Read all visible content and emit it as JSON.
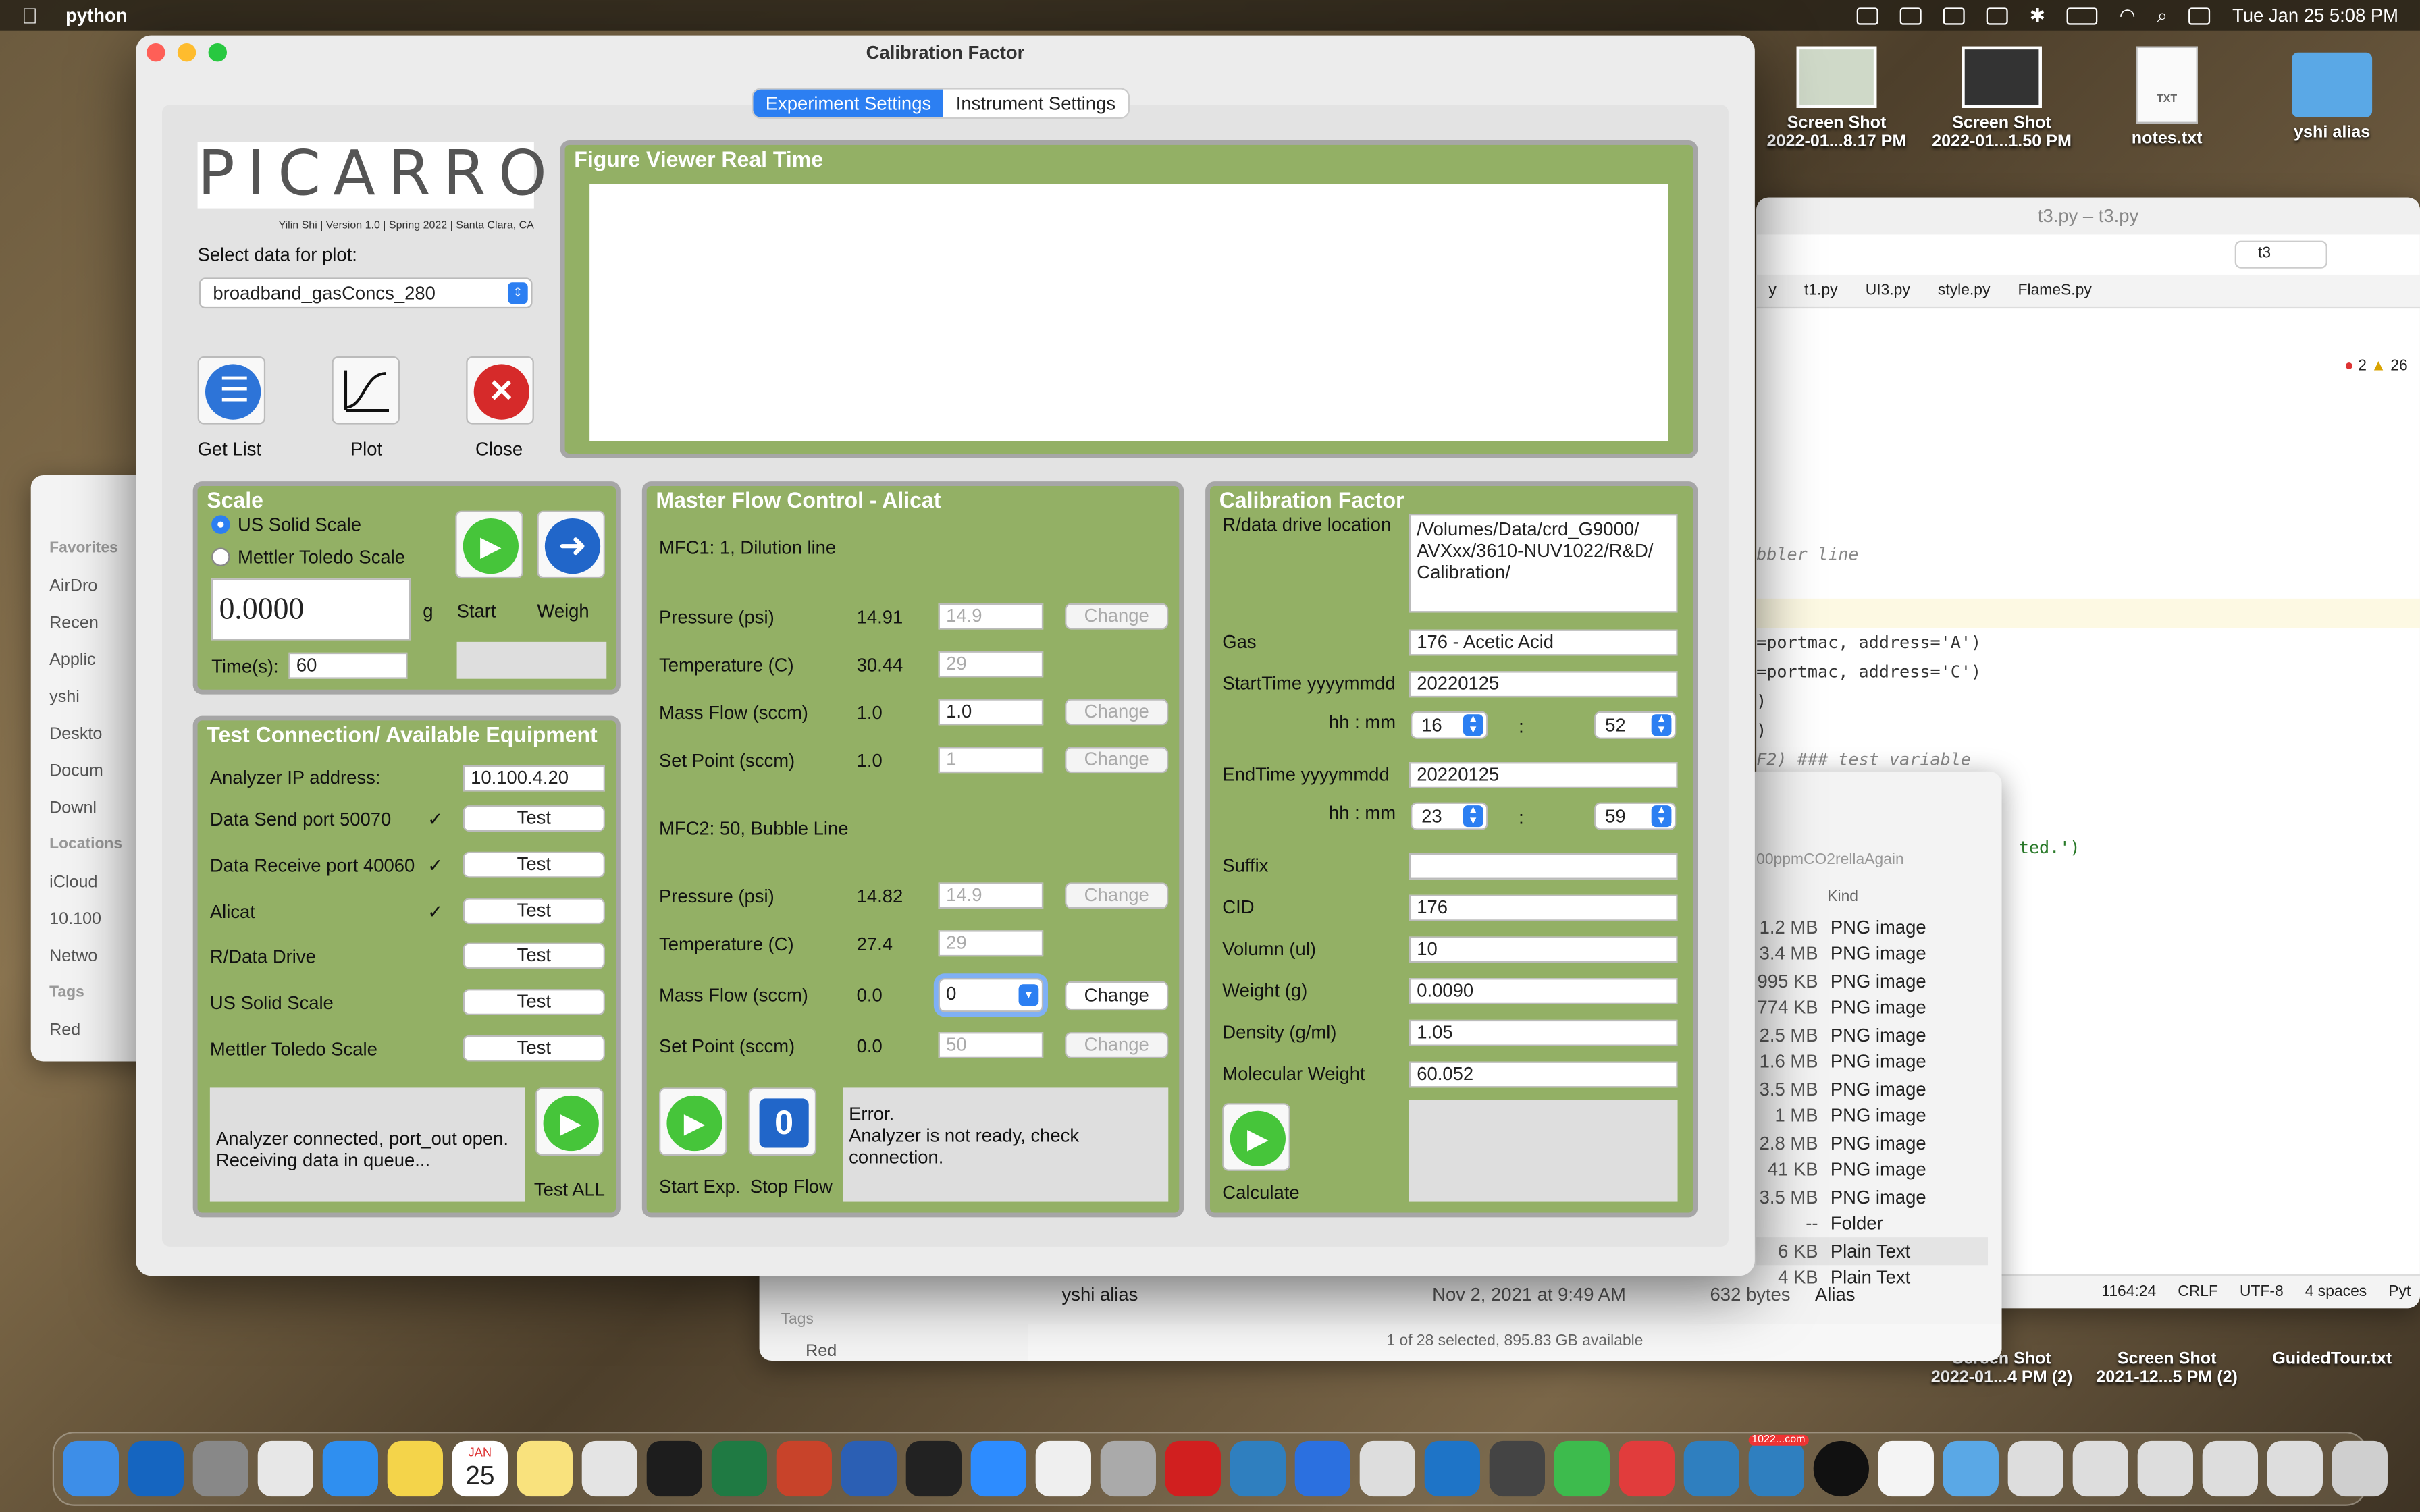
{
  "menubar": {
    "apple": "",
    "app_name": "python",
    "clock": "Tue Jan 25  5:08 PM"
  },
  "desktop": {
    "icons": [
      {
        "label": "Screen Shot\n2022-01...8.17 PM"
      },
      {
        "label": "Screen Shot\n2022-01...1.50 PM"
      },
      {
        "label": "notes.txt"
      },
      {
        "label": "yshi alias"
      },
      {
        "label": "Screen Shot\n2022-01...4 PM (2)"
      },
      {
        "label": "Screen Shot\n2021-12...5 PM (2)"
      },
      {
        "label": "GuidedTour.txt"
      }
    ]
  },
  "ide": {
    "title": "t3.py – t3.py",
    "run_config": "t3",
    "tabs": [
      "y",
      "t1.py",
      "UI3.py",
      "style.py",
      "FlameS.py"
    ],
    "errors": "2",
    "warnings": "26",
    "code_lines": [
      "bbler line",
      "",
      "",
      "=portmac, address='A')",
      "=portmac, address='C')",
      ")",
      ")",
      "F2)  ### test variable",
      "",
      "",
      "ted.')"
    ],
    "status": [
      "1164:24",
      "CRLF",
      "UTF-8",
      "4 spaces",
      "Pyt"
    ]
  },
  "finder_left": {
    "favorites_header": "Favorites",
    "favorites": [
      "AirDro",
      "Recen",
      "Applic",
      "yshi",
      "Deskto",
      "Docum",
      "Downl"
    ],
    "locations_header": "Locations",
    "locations": [
      "iCloud",
      "10.100",
      "Netwo"
    ],
    "tags_header": "Tags",
    "tags": [
      "Red"
    ]
  },
  "finder2": {
    "path_crumb": "00ppmCO2rellaAgain",
    "kind_header": "Kind",
    "rows": [
      {
        "size": "1.2 MB",
        "kind": "PNG image"
      },
      {
        "size": "3.4 MB",
        "kind": "PNG image"
      },
      {
        "size": "995 KB",
        "kind": "PNG image"
      },
      {
        "size": "774 KB",
        "kind": "PNG image"
      },
      {
        "size": "2.5 MB",
        "kind": "PNG image"
      },
      {
        "size": "1.6 MB",
        "kind": "PNG image"
      },
      {
        "size": "3.5 MB",
        "kind": "PNG image"
      },
      {
        "size": "1 MB",
        "kind": "PNG image"
      },
      {
        "size": "2.8 MB",
        "kind": "PNG image"
      },
      {
        "size": "41 KB",
        "kind": "PNG image"
      },
      {
        "size": "3.5 MB",
        "kind": "PNG image"
      },
      {
        "size": "--",
        "kind": "Folder"
      },
      {
        "size": "6 KB",
        "kind": "Plain Text"
      },
      {
        "size": "4 KB",
        "kind": "Plain Text"
      }
    ],
    "alias_row": {
      "name": "yshi alias",
      "date": "Nov 2, 2021 at 9:49 AM",
      "size": "632 bytes",
      "kind": "Alias"
    },
    "tags_header": "Tags",
    "tag_red": "Red",
    "status": "1 of 28 selected, 895.83 GB available"
  },
  "window": {
    "title": "Calibration Factor",
    "tabs": {
      "experiment": "Experiment Settings",
      "instrument": "Instrument Settings"
    },
    "logo": "PICARRO",
    "credit": "Yilin Shi | Version 1.0 | Spring 2022 | Santa Clara, CA",
    "select_label": "Select data for plot:",
    "select_value": "broadband_gasConcs_280",
    "buttons": {
      "get_list": "Get List",
      "plot": "Plot",
      "close": "Close"
    },
    "figure": {
      "title": "Figure Viewer Real Time"
    },
    "scale": {
      "title": "Scale",
      "opt1": "US Solid Scale",
      "opt2": "Mettler Toledo Scale",
      "reading": "0.0000",
      "unit": "g",
      "time_label": "Time(s):",
      "time_value": "60",
      "start": "Start",
      "weigh": "Weigh"
    },
    "test": {
      "title": "Test Connection/ Available Equipment",
      "ip_label": "Analyzer IP address:",
      "ip_value": "10.100.4.20",
      "rows": [
        {
          "label": "Data Send port 50070",
          "check": "✓",
          "btn": "Test"
        },
        {
          "label": "Data Receive port 40060",
          "check": "✓",
          "btn": "Test"
        },
        {
          "label": "Alicat",
          "check": "✓",
          "btn": "Test"
        },
        {
          "label": "R/Data Drive",
          "check": "",
          "btn": "Test"
        },
        {
          "label": "US Solid Scale",
          "check": "",
          "btn": "Test"
        },
        {
          "label": "Mettler Toledo Scale",
          "check": "",
          "btn": "Test"
        }
      ],
      "status_line1": "Analyzer connected, port_out open.",
      "status_line2": "Receiving data in queue...",
      "test_all": "Test ALL"
    },
    "mfc": {
      "title": "Master Flow Control - Alicat",
      "mfc1_header": "MFC1: 1, Dilution line",
      "mfc1": [
        {
          "label": "Pressure (psi)",
          "value": "14.91",
          "input": "14.9",
          "dim": true,
          "btn": "Change",
          "btn_dim": true
        },
        {
          "label": "Temperature (C)",
          "value": "30.44",
          "input": "29",
          "dim": true,
          "btn": "",
          "btn_dim": true
        },
        {
          "label": "Mass Flow (sccm)",
          "value": "1.0",
          "input": "1.0",
          "dim": false,
          "btn": "Change",
          "btn_dim": true
        },
        {
          "label": "Set Point (sccm)",
          "value": "1.0",
          "input": "1",
          "dim": true,
          "btn": "Change",
          "btn_dim": true
        }
      ],
      "mfc2_header": "MFC2: 50, Bubble Line",
      "mfc2": [
        {
          "label": "Pressure (psi)",
          "value": "14.82",
          "input": "14.9",
          "dim": true,
          "btn": "Change",
          "btn_dim": true
        },
        {
          "label": "Temperature (C)",
          "value": "27.4",
          "input": "29",
          "dim": true,
          "btn": "",
          "btn_dim": true
        },
        {
          "label": "Mass Flow (sccm)",
          "value": "0.0",
          "input": "0",
          "dim": false,
          "btn": "Change",
          "btn_dim": false
        },
        {
          "label": "Set Point (sccm)",
          "value": "0.0",
          "input": "50",
          "dim": true,
          "btn": "Change",
          "btn_dim": true
        }
      ],
      "start_exp": "Start Exp.",
      "stop_flow": "Stop Flow",
      "error_line1": "Error.",
      "error_line2": "Analyzer is not ready, check connection."
    },
    "calib": {
      "title": "Calibration Factor",
      "drive_label": "R/data drive location",
      "drive_value": "/Volumes/Data/crd_G9000/\nAVXxx/3610-NUV1022/R&D/\nCalibration/",
      "gas_label": "Gas",
      "gas_value": "176 - Acetic Acid",
      "start_label": "StartTime yyyymmdd",
      "start_value": "20220125",
      "hhmm": "hh : mm",
      "colon": ":",
      "start_hh": "16",
      "start_mm": "52",
      "end_label": "EndTime yyyymmdd",
      "end_value": "20220125",
      "end_hh": "23",
      "end_mm": "59",
      "fields": [
        {
          "label": "Suffix",
          "value": ""
        },
        {
          "label": "CID",
          "value": "176"
        },
        {
          "label": "Volumn (ul)",
          "value": "10"
        },
        {
          "label": "Weight (g)",
          "value": "0.0090"
        },
        {
          "label": "Density (g/ml)",
          "value": "1.05"
        },
        {
          "label": "Molecular Weight",
          "value": "60.052"
        }
      ],
      "calculate": "Calculate"
    }
  },
  "dock": {
    "date_icon_month": "JAN",
    "date_icon_day": "25",
    "badge": "1022...com"
  }
}
